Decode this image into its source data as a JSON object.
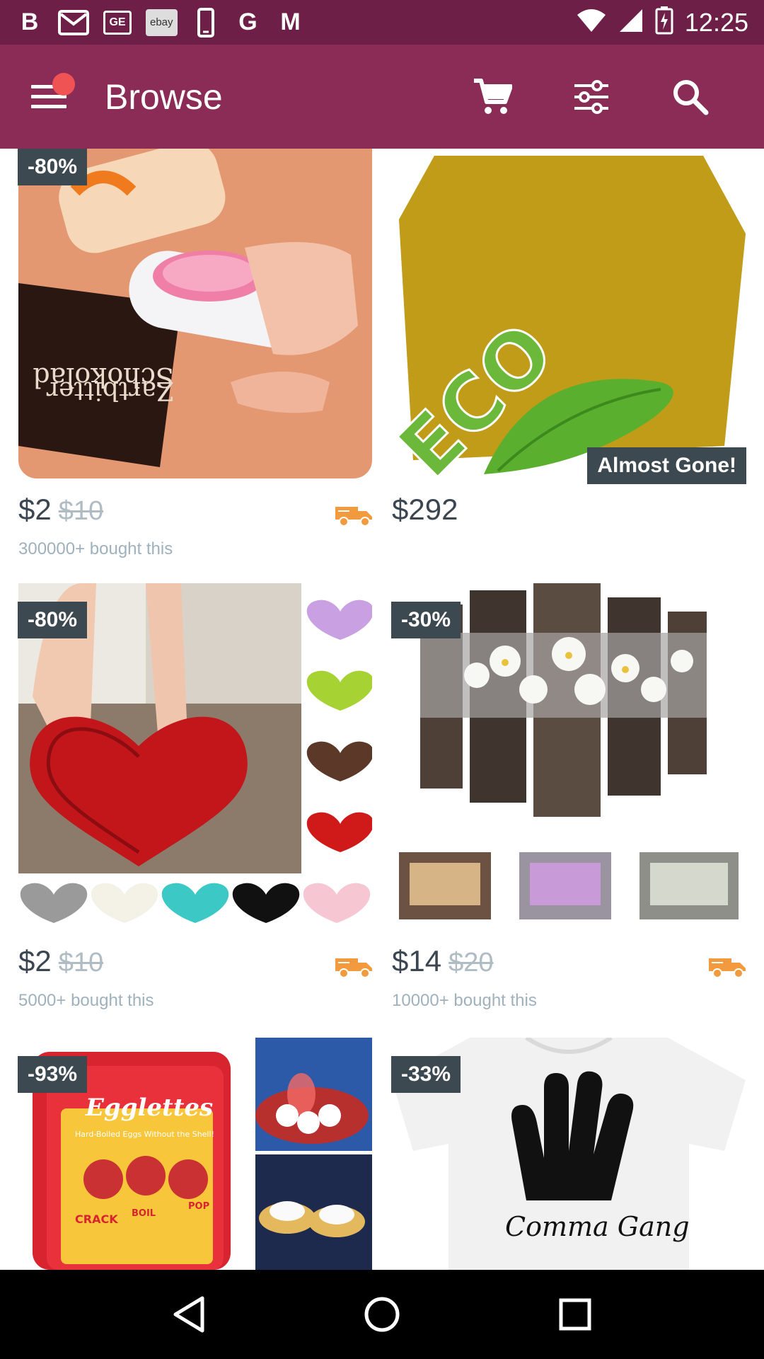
{
  "status_bar": {
    "time": "12:25",
    "left_icons": [
      "b-icon",
      "gmail-icon",
      "ge-icon",
      "ebay-icon",
      "phone-icon",
      "google-icon",
      "m-icon"
    ],
    "ge_text": "GE",
    "ebay_text": "ebay",
    "b_text": "B",
    "g_text": "G",
    "m_text": "M"
  },
  "app_bar": {
    "title": "Browse",
    "bg_color": "#8a2c55",
    "status_color": "#6d1f47",
    "notification_dot_color": "#f05353"
  },
  "products": [
    {
      "badge": "-80%",
      "price": "$2",
      "old_price": "$10",
      "bought": "300000+ bought this",
      "shipping_icon": true,
      "image_desc_icon": "bag-sealer-image"
    },
    {
      "badge": "",
      "tag": "Almost Gone!",
      "price": "$292",
      "old_price": "",
      "bought": "",
      "shipping_icon": false,
      "image_eco_text": "ECO"
    },
    {
      "badge": "-80%",
      "price": "$2",
      "old_price": "$10",
      "bought": "5000+ bought this",
      "shipping_icon": true
    },
    {
      "badge": "-30%",
      "price": "$14",
      "old_price": "$20",
      "bought": "10000+ bought this",
      "shipping_icon": true
    },
    {
      "badge": "-93%",
      "image_brand": "Egglettes",
      "image_tagline": "Hard-Boiled Eggs Without the Shell!",
      "image_words": [
        "CRACK",
        "BOIL",
        "POP"
      ]
    },
    {
      "badge": "-33%",
      "image_text": "Comma Gang"
    }
  ],
  "accent_colors": {
    "badge_bg": "#3d4950",
    "shipping_orange": "#f19a3e",
    "price_text": "#3b4650",
    "muted_text": "#9fb1bd"
  }
}
